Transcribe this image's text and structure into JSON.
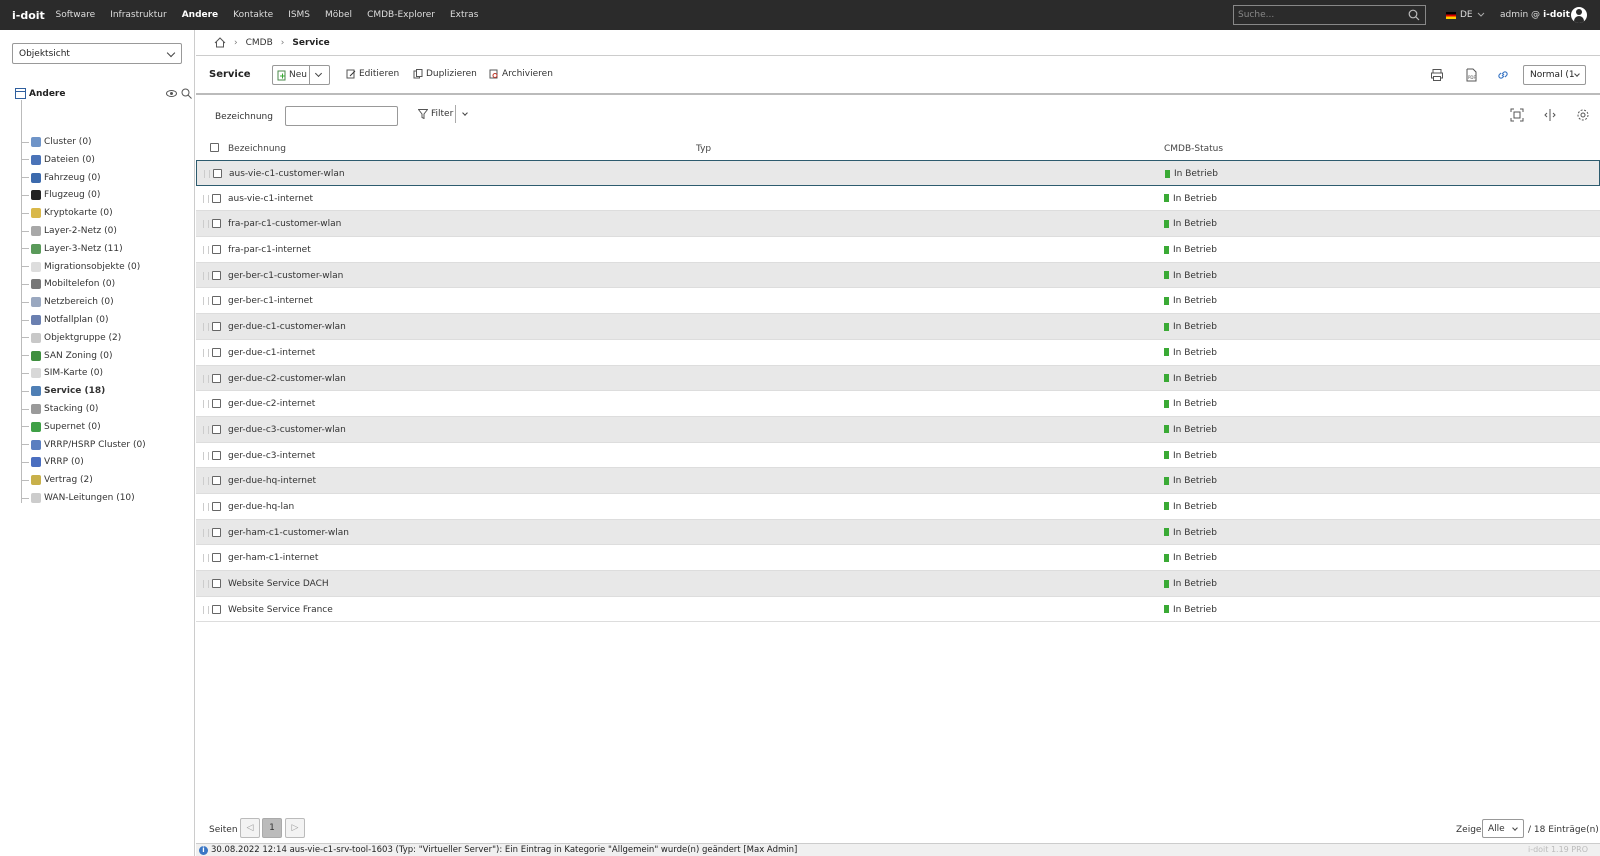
{
  "app": {
    "logo": "i-doit",
    "nav": [
      "Software",
      "Infrastruktur",
      "Andere",
      "Kontakte",
      "ISMS",
      "Möbel",
      "CMDB-Explorer",
      "Extras"
    ],
    "nav_active": "Andere",
    "search_placeholder": "Suche...",
    "language": "DE",
    "user": "admin @",
    "tenant": "i-doit"
  },
  "sidebar": {
    "view_select": "Objektsicht",
    "root": "Andere",
    "items": [
      {
        "label": "Cluster (0)",
        "color": "#6f94c8"
      },
      {
        "label": "Dateien (0)",
        "color": "#4a73b8"
      },
      {
        "label": "Fahrzeug (0)",
        "color": "#3c6aad"
      },
      {
        "label": "Flugzeug (0)",
        "color": "#222222"
      },
      {
        "label": "Kryptokarte (0)",
        "color": "#d9b84a"
      },
      {
        "label": "Layer-2-Netz (0)",
        "color": "#a8a8a8"
      },
      {
        "label": "Layer-3-Netz (11)",
        "color": "#5a9a5a"
      },
      {
        "label": "Migrationsobjekte (0)",
        "color": "#dddddd"
      },
      {
        "label": "Mobiltelefon (0)",
        "color": "#777777"
      },
      {
        "label": "Netzbereich (0)",
        "color": "#9aa8c0"
      },
      {
        "label": "Notfallplan (0)",
        "color": "#6a7fb0"
      },
      {
        "label": "Objektgruppe (2)",
        "color": "#c8c8c8"
      },
      {
        "label": "SAN Zoning (0)",
        "color": "#3f8f3f"
      },
      {
        "label": "SIM-Karte (0)",
        "color": "#d8d8d8"
      },
      {
        "label": "Service (18)",
        "color": "#4f7fb5"
      },
      {
        "label": "Stacking (0)",
        "color": "#9a9a9a"
      },
      {
        "label": "Supernet (0)",
        "color": "#3fa046"
      },
      {
        "label": "VRRP/HSRP Cluster (0)",
        "color": "#5b7fc0"
      },
      {
        "label": "VRRP (0)",
        "color": "#4a6ec0"
      },
      {
        "label": "Vertrag (2)",
        "color": "#c8b04a"
      },
      {
        "label": "WAN-Leitungen (10)",
        "color": "#cccccc"
      }
    ],
    "selected": "Service (18)"
  },
  "breadcrumb": {
    "cmdb": "CMDB",
    "current": "Service"
  },
  "toolbar": {
    "title": "Service",
    "new": "Neu",
    "edit": "Editieren",
    "duplicate": "Duplizieren",
    "archive": "Archivieren",
    "mode": "Normal (1"
  },
  "filter": {
    "label": "Bezeichnung",
    "button": "Filter"
  },
  "table": {
    "columns": {
      "name": "Bezeichnung",
      "typ": "Typ",
      "status": "CMDB-Status"
    },
    "rows": [
      {
        "name": "aus-vie-c1-customer-wlan",
        "status": "In Betrieb"
      },
      {
        "name": "aus-vie-c1-internet",
        "status": "In Betrieb"
      },
      {
        "name": "fra-par-c1-customer-wlan",
        "status": "In Betrieb"
      },
      {
        "name": "fra-par-c1-internet",
        "status": "In Betrieb"
      },
      {
        "name": "ger-ber-c1-customer-wlan",
        "status": "In Betrieb"
      },
      {
        "name": "ger-ber-c1-internet",
        "status": "In Betrieb"
      },
      {
        "name": "ger-due-c1-customer-wlan",
        "status": "In Betrieb"
      },
      {
        "name": "ger-due-c1-internet",
        "status": "In Betrieb"
      },
      {
        "name": "ger-due-c2-customer-wlan",
        "status": "In Betrieb"
      },
      {
        "name": "ger-due-c2-internet",
        "status": "In Betrieb"
      },
      {
        "name": "ger-due-c3-customer-wlan",
        "status": "In Betrieb"
      },
      {
        "name": "ger-due-c3-internet",
        "status": "In Betrieb"
      },
      {
        "name": "ger-due-hq-internet",
        "status": "In Betrieb"
      },
      {
        "name": "ger-due-hq-lan",
        "status": "In Betrieb"
      },
      {
        "name": "ger-ham-c1-customer-wlan",
        "status": "In Betrieb"
      },
      {
        "name": "ger-ham-c1-internet",
        "status": "In Betrieb"
      },
      {
        "name": "Website Service DACH",
        "status": "In Betrieb"
      },
      {
        "name": "Website Service France",
        "status": "In Betrieb"
      }
    ],
    "status_color": "#3aaa35"
  },
  "pager": {
    "label": "Seiten",
    "current_page": "1",
    "show_label": "Zeige",
    "per_page": "Alle",
    "entries": "/ 18 Einträge(n)"
  },
  "statusbar": {
    "message": "30.08.2022 12:14 aus-vie-c1-srv-tool-1603 (Typ: \"Virtueller Server\"): Ein Eintrag in Kategorie \"Allgemein\" wurde(n) geändert [Max Admin]",
    "version": "i-doit 1.19 PRO"
  }
}
